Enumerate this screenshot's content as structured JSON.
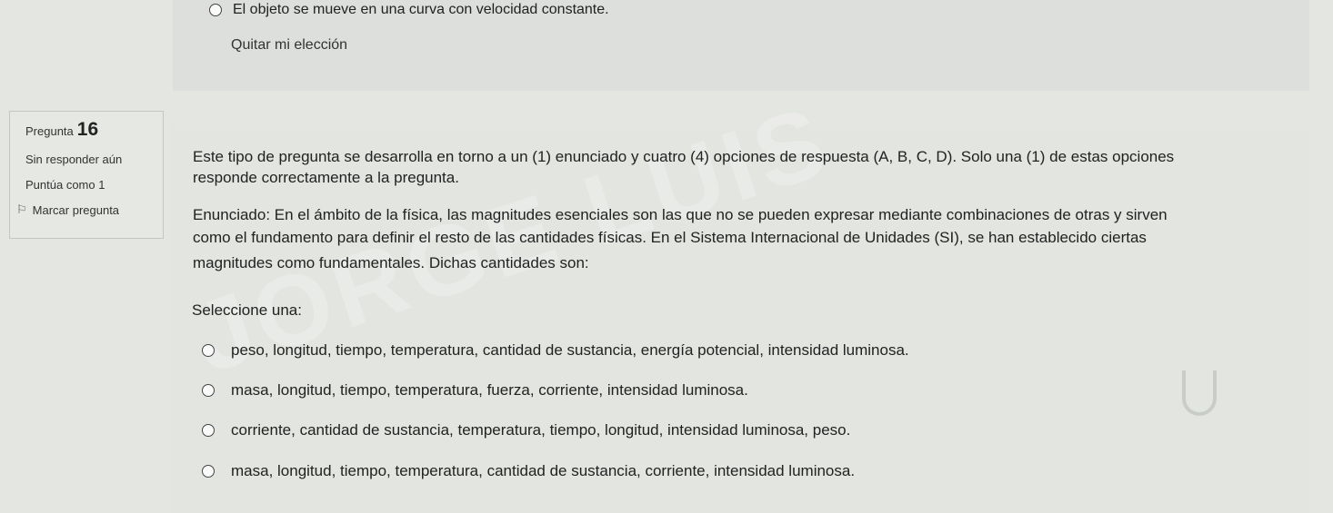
{
  "previous_question": {
    "last_option_label": "El objeto se mueve en una curva con velocidad constante.",
    "clear_choice_label": "Quitar mi elección"
  },
  "question_info": {
    "prefix": "Pregunta",
    "number": "16",
    "status": "Sin responder aún",
    "score": "Puntúa como 1",
    "flag_label": "Marcar pregunta"
  },
  "question": {
    "intro_line1": "Este tipo de pregunta se desarrolla en torno a un (1) enunciado y cuatro (4) opciones de respuesta (A, B, C, D). Solo una (1) de estas opciones",
    "intro_line2": "responde correctamente a la pregunta.",
    "statement_line1": "Enunciado: En el ámbito de la física, las magnitudes esenciales son las que no se pueden expresar mediante combinaciones de otras y sirven",
    "statement_line2": "como el fundamento para definir el resto de las cantidades físicas. En el Sistema Internacional de Unidades (SI), se han establecido ciertas",
    "statement_line3": "magnitudes como fundamentales.  Dichas cantidades son:",
    "select_label": "Seleccione una:",
    "options": [
      "peso, longitud, tiempo, temperatura, cantidad de sustancia, energía potencial, intensidad luminosa.",
      "masa, longitud, tiempo, temperatura, fuerza, corriente, intensidad luminosa.",
      "corriente, cantidad de sustancia, temperatura, tiempo, longitud, intensidad luminosa, peso.",
      "masa, longitud, tiempo, temperatura, cantidad de sustancia, corriente, intensidad luminosa."
    ]
  }
}
